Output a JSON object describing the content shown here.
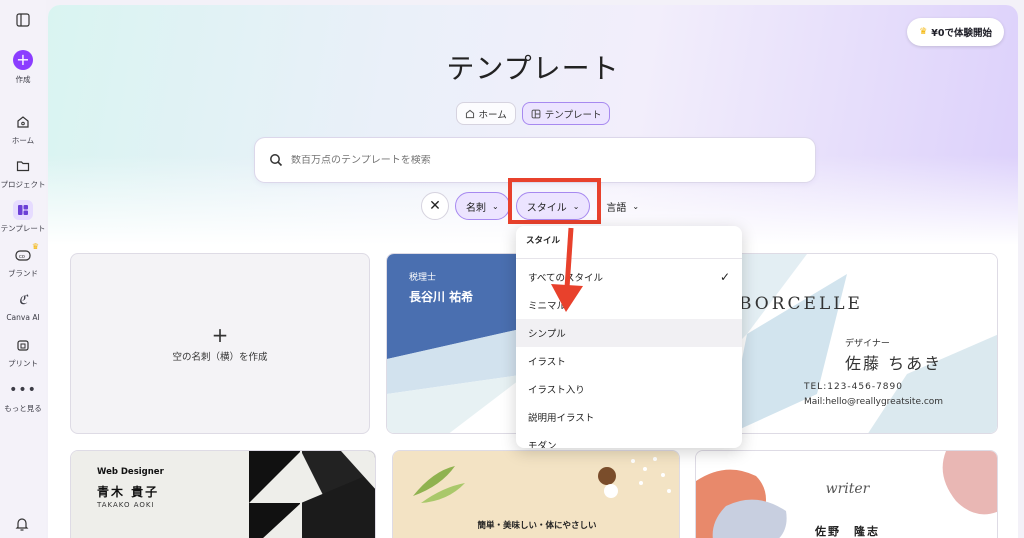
{
  "rail": {
    "create": "作成",
    "home": "ホーム",
    "projects": "プロジェクト",
    "templates": "テンプレート",
    "brand": "ブランド",
    "canva_ai": "Canva AI",
    "print": "プリント",
    "more": "もっと見る"
  },
  "header": {
    "trial_button": "¥0で体験開始",
    "title": "テンプレート",
    "breadcrumb": [
      "ホーム",
      "テンプレート"
    ]
  },
  "search": {
    "placeholder": "数百万点のテンプレートを検索"
  },
  "filters": {
    "clear_icon": "close-icon",
    "meishi": "名刺",
    "style": "スタイル",
    "language": "言語"
  },
  "dropdown": {
    "title": "スタイル",
    "items": [
      "すべてのスタイル",
      "ミニマル",
      "シンプル",
      "イラスト",
      "イラスト入り",
      "説明用イラスト",
      "モダン"
    ]
  },
  "blank_card": {
    "label": "空の名刺（横）を作成"
  },
  "cards": {
    "c1": {
      "role": "税理士",
      "name": "長谷川 祐希"
    },
    "c2": {
      "brand": "BORCELLE",
      "role": "デザイナー",
      "name": "佐藤 ちあき",
      "tel": "TEL:123-456-7890",
      "mail": "Mail:hello@reallygreatsite.com"
    },
    "c3": {
      "role": "Web Designer",
      "name": "青木 貴子",
      "romaji": "TAKAKO AOKI"
    },
    "c4": {
      "tagline": "簡単・美味しい・体にやさしい"
    },
    "c5": {
      "role": "writer",
      "name": "佐野　隆志"
    }
  },
  "colors": {
    "accent": "#8b3dff",
    "highlight": "#e8412c",
    "chip_bg": "#ece4ff"
  }
}
